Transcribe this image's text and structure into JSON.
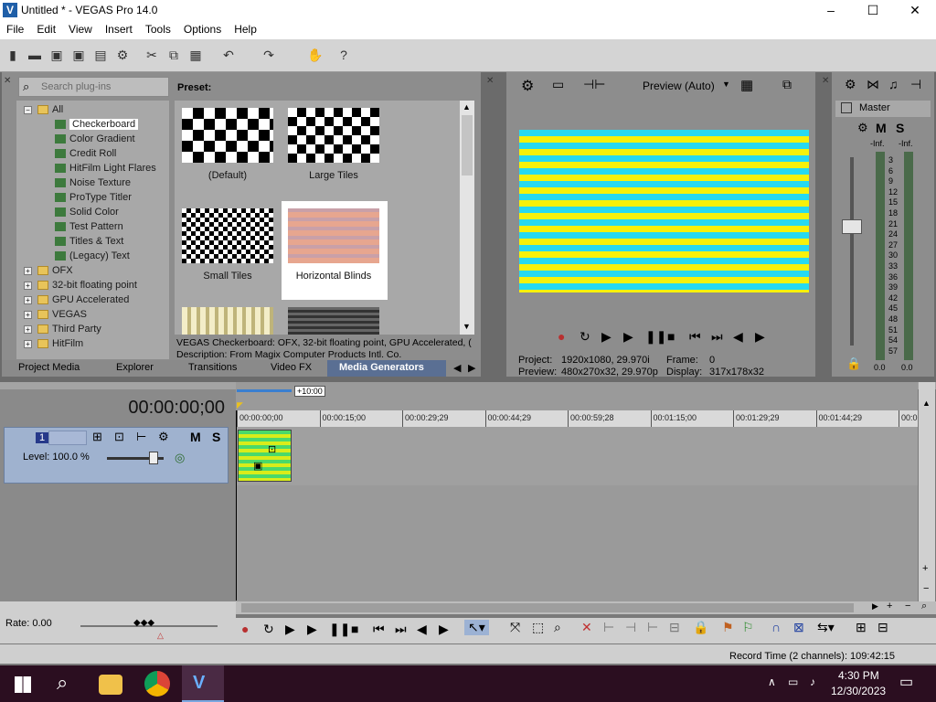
{
  "window": {
    "title": "Untitled * - VEGAS Pro 14.0",
    "controls": [
      "–",
      "☐",
      "✕"
    ]
  },
  "menu": [
    "File",
    "Edit",
    "View",
    "Insert",
    "Tools",
    "Options",
    "Help"
  ],
  "generators": {
    "search_placeholder": "Search plug-ins",
    "preset_label": "Preset:",
    "tree": [
      {
        "label": "All",
        "type": "folder",
        "expanded": true
      },
      {
        "label": "Checkerboard",
        "type": "plugin",
        "selected": true
      },
      {
        "label": "Color Gradient",
        "type": "plugin"
      },
      {
        "label": "Credit Roll",
        "type": "plugin"
      },
      {
        "label": "HitFilm Light Flares",
        "type": "plugin"
      },
      {
        "label": "Noise Texture",
        "type": "plugin"
      },
      {
        "label": "ProType Titler",
        "type": "plugin"
      },
      {
        "label": "Solid Color",
        "type": "plugin"
      },
      {
        "label": "Test Pattern",
        "type": "plugin"
      },
      {
        "label": "Titles & Text",
        "type": "plugin"
      },
      {
        "label": "(Legacy) Text",
        "type": "plugin"
      },
      {
        "label": "OFX",
        "type": "folder"
      },
      {
        "label": "32-bit floating point",
        "type": "folder"
      },
      {
        "label": "GPU Accelerated",
        "type": "folder"
      },
      {
        "label": "VEGAS",
        "type": "folder"
      },
      {
        "label": "Third Party",
        "type": "folder"
      },
      {
        "label": "HitFilm",
        "type": "folder"
      }
    ],
    "presets": [
      "(Default)",
      "Large Tiles",
      "Small Tiles",
      "Horizontal Blinds"
    ],
    "info_line1": "VEGAS Checkerboard: OFX, 32-bit floating point, GPU Accelerated, (",
    "info_line2": "Description: From Magix Computer Products Intl. Co.",
    "tabs": [
      "Project Media",
      "Explorer",
      "Transitions",
      "Video FX",
      "Media Generators"
    ],
    "active_tab": "Media Generators"
  },
  "preview": {
    "mode": "Preview (Auto)",
    "project_label": "Project:",
    "project": "1920x1080, 29.970i",
    "preview_label": "Preview:",
    "preview_val": "480x270x32, 29.970p",
    "frame_label": "Frame:",
    "frame": "0",
    "display_label": "Display:",
    "display": "317x178x32"
  },
  "mixer": {
    "title": "Master",
    "m": "M",
    "s": "S",
    "inf_left": "-Inf.",
    "inf_right": "-Inf.",
    "scale": [
      "3",
      "6",
      "9",
      "12",
      "15",
      "18",
      "21",
      "24",
      "27",
      "30",
      "33",
      "36",
      "39",
      "42",
      "45",
      "48",
      "51",
      "54",
      "57"
    ],
    "bottom_left": "0.0",
    "bottom_right": "0.0"
  },
  "timeline": {
    "timecode": "00:00:00;00",
    "marker": "+10:00",
    "track_number": "1",
    "level": "Level: 100.0 %",
    "m": "M",
    "s": "S",
    "ruler": [
      "00:00:00;00",
      "00:00:15;00",
      "00:00:29;29",
      "00:00:44;29",
      "00:00:59;28",
      "00:01:15;00",
      "00:01:29;29",
      "00:01:44;29",
      "00:0"
    ],
    "rate": "Rate: 0.00"
  },
  "status": {
    "record_time": "Record Time (2 channels): 109:42:15"
  },
  "taskbar": {
    "time": "4:30 PM",
    "date": "12/30/2023"
  }
}
